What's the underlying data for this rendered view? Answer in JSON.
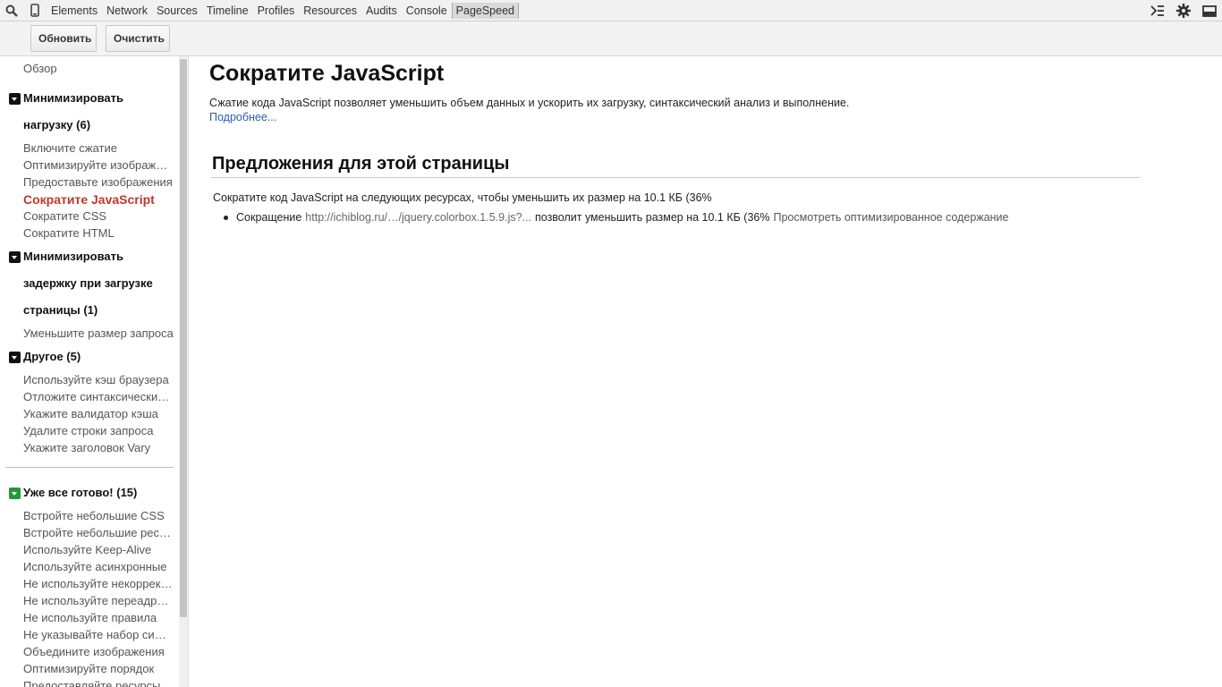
{
  "tabbar": {
    "tabs": [
      "Elements",
      "Network",
      "Sources",
      "Timeline",
      "Profiles",
      "Resources",
      "Audits",
      "Console",
      "PageSpeed"
    ],
    "active_tab": "PageSpeed"
  },
  "toolbar": {
    "refresh_label": "Обновить",
    "clear_label": "Очистить"
  },
  "sidebar": {
    "overview": "Обзор",
    "group1_line1": "Минимизировать",
    "group1_line2": "нагрузку (6)",
    "group1_items": [
      "Включите сжатие",
      "Оптимизируйте изображения",
      "Предоставьте изображения",
      "Сократите JavaScript",
      "Сократите CSS",
      "Сократите HTML"
    ],
    "group2_line1": "Минимизировать",
    "group2_line2": "задержку при загрузке",
    "group2_line3": "страницы (1)",
    "group2_items": [
      "Уменьшите размер запроса"
    ],
    "group3_title": "Другое (5)",
    "group3_items": [
      "Используйте кэш браузера",
      "Отложите синтаксический анализ",
      "Укажите валидатор кэша",
      "Удалите строки запроса",
      "Укажите заголовок Vary"
    ],
    "group4_title": "Уже все готово! (15)",
    "group4_items": [
      "Встройте небольшие CSS",
      "Встройте небольшие ресурсы",
      "Используйте Keep-Alive",
      "Используйте асинхронные",
      "Не используйте некорректные",
      "Не используйте переадресацию",
      "Не используйте правила",
      "Не указывайте набор символов",
      "Объедините изображения",
      "Оптимизируйте порядок",
      "Предоставляйте ресурсы"
    ]
  },
  "main": {
    "title": "Сократите JavaScript",
    "description": "Сжатие кода JavaScript позволяет уменьшить объем данных и ускорить их загрузку, синтаксический анализ и выполнение.",
    "more_link": "Подробнее...",
    "section_title": "Предложения для этой страницы",
    "suggestion": "Сократите код JavaScript на следующих ресурсах, чтобы уменьшить их размер на 10.1 КБ (36%",
    "bullet_prefix": "Сокращение",
    "bullet_url": "http://ichiblog.ru/…/jquery.colorbox.1.5.9.js?...",
    "bullet_middle": "позволит уменьшить размер на 10.1 КБ (36%",
    "bullet_link": "Просмотреть оптимизированное содержание"
  }
}
